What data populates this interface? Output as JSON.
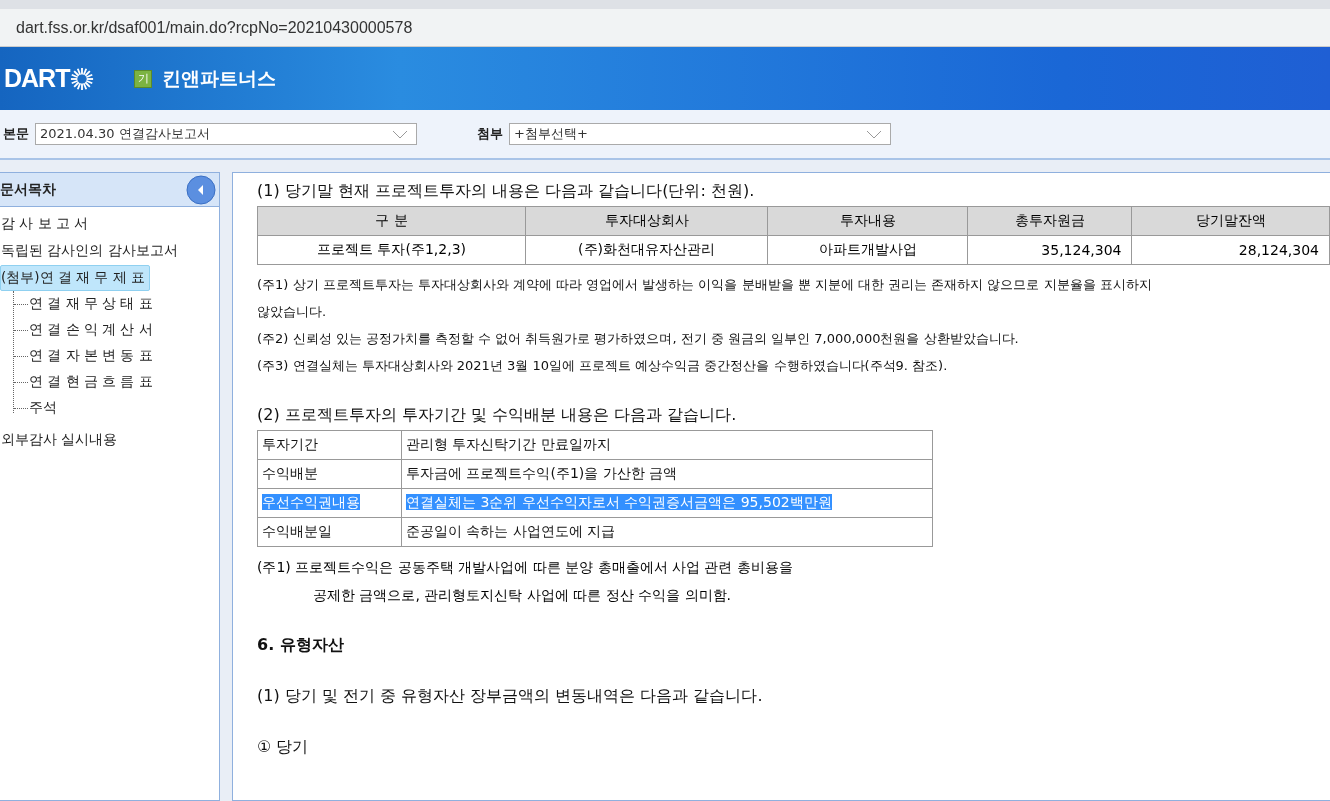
{
  "browser": {
    "url": "dart.fss.or.kr/dsaf001/main.do?rcpNo=20210430000578"
  },
  "header": {
    "logo": "DART",
    "company_badge": "기",
    "company": "킨앤파트너스"
  },
  "selectors": [
    {
      "label": "본문",
      "value": "2021.04.30  연결감사보고서"
    },
    {
      "label": "첨부",
      "value": "+첨부선택+"
    }
  ],
  "sidebar": {
    "title": "문서목차",
    "items": [
      {
        "label": "감 사 보 고 서",
        "selected": false
      },
      {
        "label": "독립된 감사인의 감사보고서",
        "selected": false
      },
      {
        "label": "(첨부)연 결 재 무 제 표",
        "selected": true,
        "children": [
          {
            "label": "연 결 재 무 상 태 표",
            "selected": false
          },
          {
            "label": "연 결 손 익 계 산 서",
            "selected": false
          },
          {
            "label": "연 결 자 본 변 동 표",
            "selected": false
          },
          {
            "label": "연 결 현 금 흐 름 표",
            "selected": false
          },
          {
            "label": "주석",
            "selected": false
          }
        ]
      },
      {
        "label": "외부감사 실시내용",
        "selected": false
      }
    ]
  },
  "content": [
    {
      "kind": "paragraph",
      "text": "(1) 당기말 현재 프로젝트투자의 내용은 다음과 같습니다(단위: 천원)."
    },
    {
      "kind": "grid",
      "columns": [
        "구 분",
        "투자대상회사",
        "투자내용",
        "총투자원금",
        "당기말잔액"
      ],
      "rows": [
        [
          "프로젝트 투자(주1,2,3)",
          "(주)화천대유자산관리",
          "아파트개발사업",
          "35,124,304",
          "28,124,304"
        ]
      ]
    },
    {
      "kind": "note",
      "text": "(주1) 상기 프로젝트투자는 투자대상회사와 계약에 따라 영업에서 발생하는 이익을 분배받을 뿐 지분에 대한 권리는 존재하지 않으므로      지분율을 표시하지 않았습니다."
    },
    {
      "kind": "note",
      "text": "(주2) 신뢰성 있는 공정가치를 측정할 수 없어 취득원가로 평가하였으며, 전기 중 원금의 일부인 7,000,000천원을 상환받았습니다."
    },
    {
      "kind": "note",
      "text": "(주3) 연결실체는 투자대상회사와 2021년 3월 10일에 프로젝트 예상수익금 중간정산을 수행하였습니다(주석9. 참조)."
    },
    {
      "kind": "paragraph",
      "text": "(2) 프로젝트투자의 투자기간 및 수익배분 내용은 다음과 같습니다."
    },
    {
      "kind": "pairs",
      "rows": [
        {
          "label": "투자기간",
          "value": "관리형 투자신탁기간 만료일까지",
          "highlighted": false
        },
        {
          "label": "수익배분",
          "value": "투자금에 프로젝트수익(주1)을 가산한 금액",
          "highlighted": false
        },
        {
          "label": "우선수익권내용",
          "value": "연결실체는 3순위 우선수익자로서 수익권증서금액은 95,502백만원",
          "highlighted": true
        },
        {
          "label": "수익배분일",
          "value": "준공일이 속하는 사업연도에 지급",
          "highlighted": false
        }
      ]
    },
    {
      "kind": "hanging",
      "text": "(주1) 프로젝트수익은 공동주택 개발사업에 따른 분양 총매출에서 사업 관련 총비용을",
      "cont": "공제한 금액으로, 관리형토지신탁 사업에 따른 정산 수익을 의미함."
    },
    {
      "kind": "heading",
      "text": "6. 유형자산"
    },
    {
      "kind": "paragraph",
      "text": "(1) 당기 및 전기 중 유형자산 장부금액의 변동내역은 다음과 같습니다."
    },
    {
      "kind": "paragraph",
      "text": "① 당기"
    }
  ]
}
